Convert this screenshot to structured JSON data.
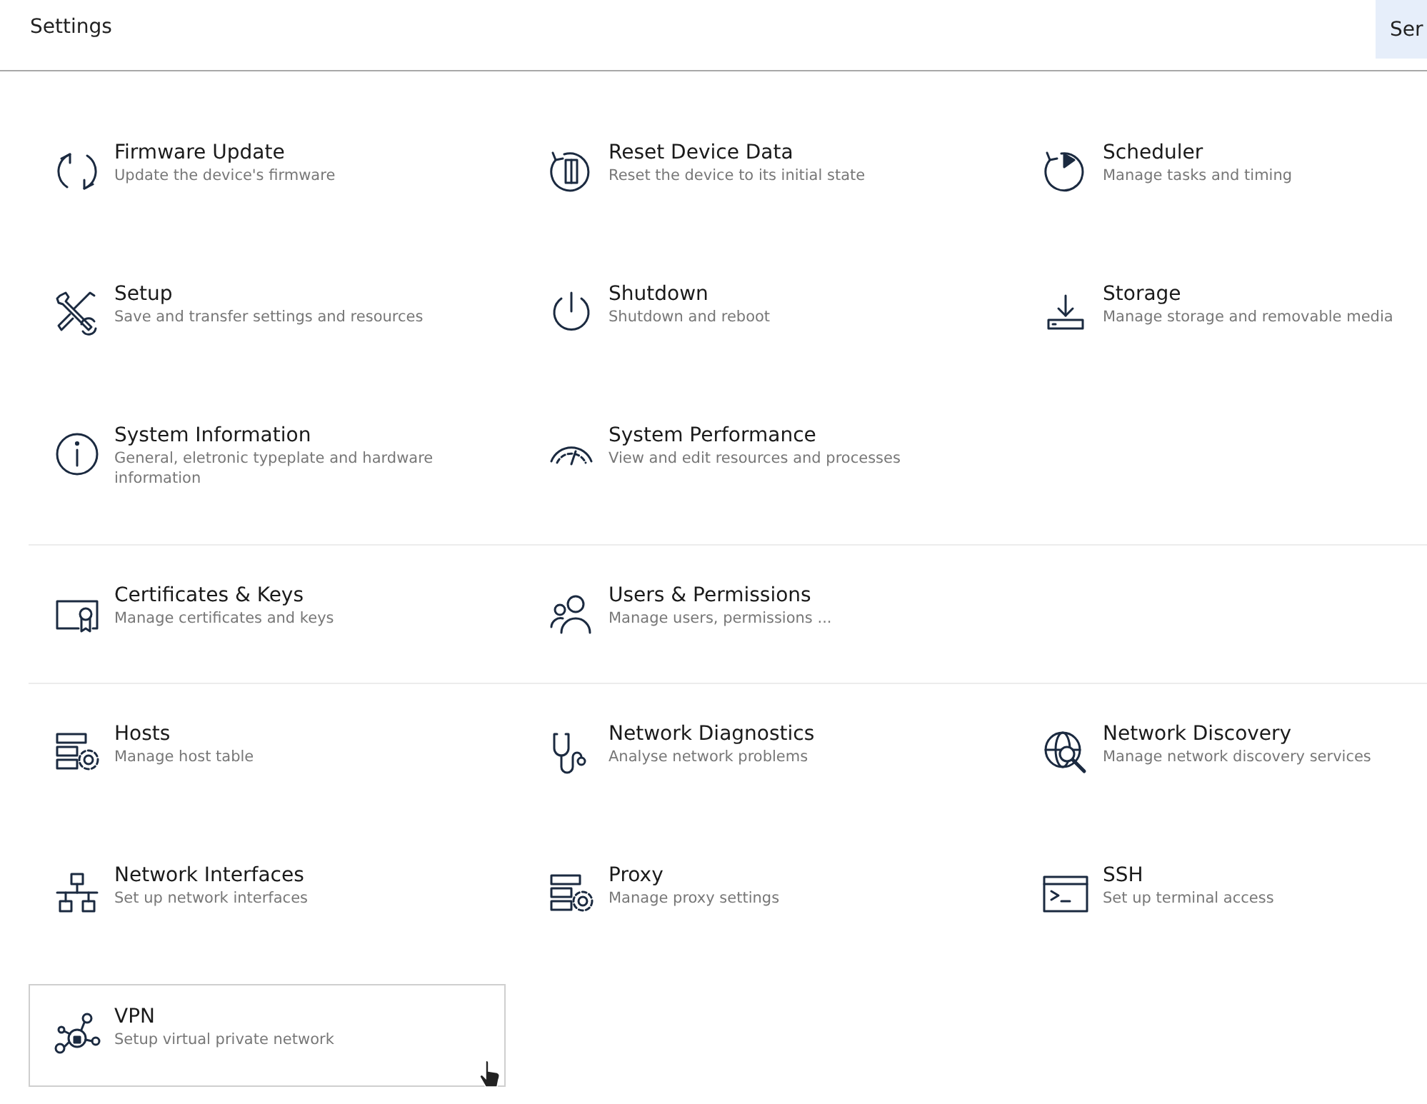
{
  "header": {
    "title": "Settings",
    "cut_tab": "Ser"
  },
  "groups": [
    {
      "items": [
        {
          "kind": "refresh",
          "title": "Firmware Update",
          "description": "Update the device's firmware",
          "hovered": false
        },
        {
          "kind": "reset",
          "title": "Reset Device Data",
          "description": "Reset the device to its initial state",
          "hovered": false
        },
        {
          "kind": "scheduler",
          "title": "Scheduler",
          "description": "Manage tasks and timing",
          "hovered": false
        },
        {
          "kind": "tools",
          "title": "Setup",
          "description": "Save and transfer settings and resources",
          "hovered": false
        },
        {
          "kind": "power",
          "title": "Shutdown",
          "description": "Shutdown and reboot",
          "hovered": false
        },
        {
          "kind": "storage",
          "title": "Storage",
          "description": "Manage storage and removable media",
          "hovered": false
        },
        {
          "kind": "info",
          "title": "System Information",
          "description": "General, eletronic typeplate and hardware information",
          "hovered": false
        },
        {
          "kind": "gauge",
          "title": "System Performance",
          "description": "View and edit resources and processes",
          "hovered": false
        }
      ]
    },
    {
      "items": [
        {
          "kind": "certificate",
          "title": "Certificates & Keys",
          "description": "Manage certificates and keys",
          "hovered": false
        },
        {
          "kind": "users",
          "title": "Users & Permissions",
          "description": "Manage users, permissions ...",
          "hovered": false
        }
      ]
    },
    {
      "items": [
        {
          "kind": "server",
          "title": "Hosts",
          "description": "Manage host table",
          "hovered": false
        },
        {
          "kind": "stethoscope",
          "title": "Network Diagnostics",
          "description": "Analyse network problems",
          "hovered": false
        },
        {
          "kind": "globe",
          "title": "Network Discovery",
          "description": "Manage network discovery services",
          "hovered": false
        },
        {
          "kind": "network",
          "title": "Network Interfaces",
          "description": "Set up network interfaces",
          "hovered": false
        },
        {
          "kind": "server",
          "title": "Proxy",
          "description": "Manage proxy settings",
          "hovered": false
        },
        {
          "kind": "terminal",
          "title": "SSH",
          "description": "Set up terminal access",
          "hovered": false
        },
        {
          "kind": "vpn",
          "title": "VPN",
          "description": "Setup virtual private network",
          "hovered": true
        }
      ]
    }
  ]
}
